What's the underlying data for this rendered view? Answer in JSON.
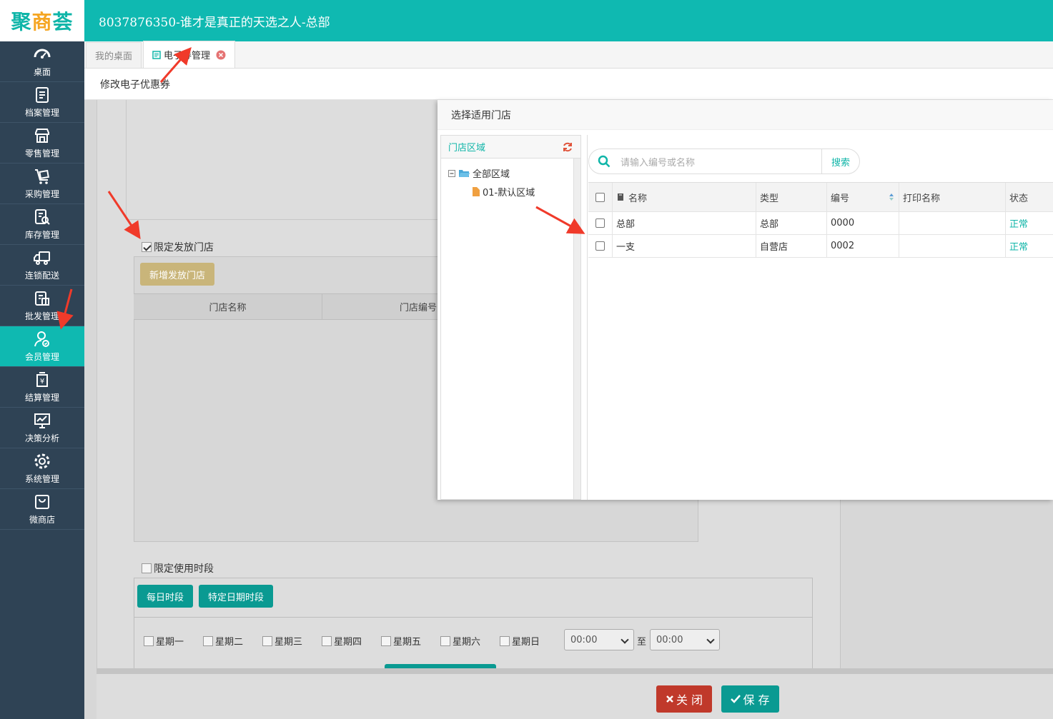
{
  "app": {
    "logo_main": "聚",
    "logo_mid": "商",
    "logo_end": "荟",
    "window_title": "8037876350-谁才是真正的天选之人-总部"
  },
  "sidebar": {
    "items": [
      {
        "label": "桌面",
        "icon": "dashboard-icon"
      },
      {
        "label": "档案管理",
        "icon": "archive-icon"
      },
      {
        "label": "零售管理",
        "icon": "store-icon"
      },
      {
        "label": "采购管理",
        "icon": "cart-icon"
      },
      {
        "label": "库存管理",
        "icon": "inventory-icon"
      },
      {
        "label": "连锁配送",
        "icon": "truck-icon"
      },
      {
        "label": "批发管理",
        "icon": "wholesale-icon"
      },
      {
        "label": "会员管理",
        "icon": "member-icon"
      },
      {
        "label": "结算管理",
        "icon": "settlement-icon"
      },
      {
        "label": "决策分析",
        "icon": "analytics-icon"
      },
      {
        "label": "系统管理",
        "icon": "gear-icon"
      },
      {
        "label": "微商店",
        "icon": "shop-bag-icon"
      }
    ],
    "active_index": 7
  },
  "tabs": [
    {
      "label": "我的桌面"
    },
    {
      "label": "电子券管理"
    }
  ],
  "subheader": {
    "title": "修改电子优惠券"
  },
  "form": {
    "limit_store_label": "限定发放门店",
    "add_store_button": "新增发放门店",
    "store_columns": [
      "门店名称",
      "门店编号"
    ],
    "limit_time_label": "限定使用时段",
    "daily_button": "每日时段",
    "date_button": "特定日期时段",
    "weekdays": [
      "星期一",
      "星期二",
      "星期三",
      "星期四",
      "星期五",
      "星期六",
      "星期日"
    ],
    "time_from": "00:00",
    "time_sep": "至",
    "time_to": "00:00",
    "close_button": "关 闭",
    "save_button": "保 存"
  },
  "modal": {
    "title": "选择适用门店",
    "area_title": "门店区域",
    "tree": [
      {
        "label": "全部区域"
      },
      {
        "label": "01-默认区域"
      }
    ],
    "search_placeholder": "请输入编号或名称",
    "search_button": "搜索",
    "columns": [
      "名称",
      "类型",
      "编号",
      "打印名称",
      "状态"
    ],
    "rows": [
      {
        "name": "总部",
        "type": "总部",
        "code": "0000",
        "print_name": "",
        "status": "正常"
      },
      {
        "name": "一支",
        "type": "自营店",
        "code": "0002",
        "print_name": "",
        "status": "正常"
      }
    ]
  },
  "colors": {
    "brand": "#0fb9b1",
    "sidebar": "#2f4355",
    "danger": "#c0392b",
    "gold": "#c9b57a"
  }
}
